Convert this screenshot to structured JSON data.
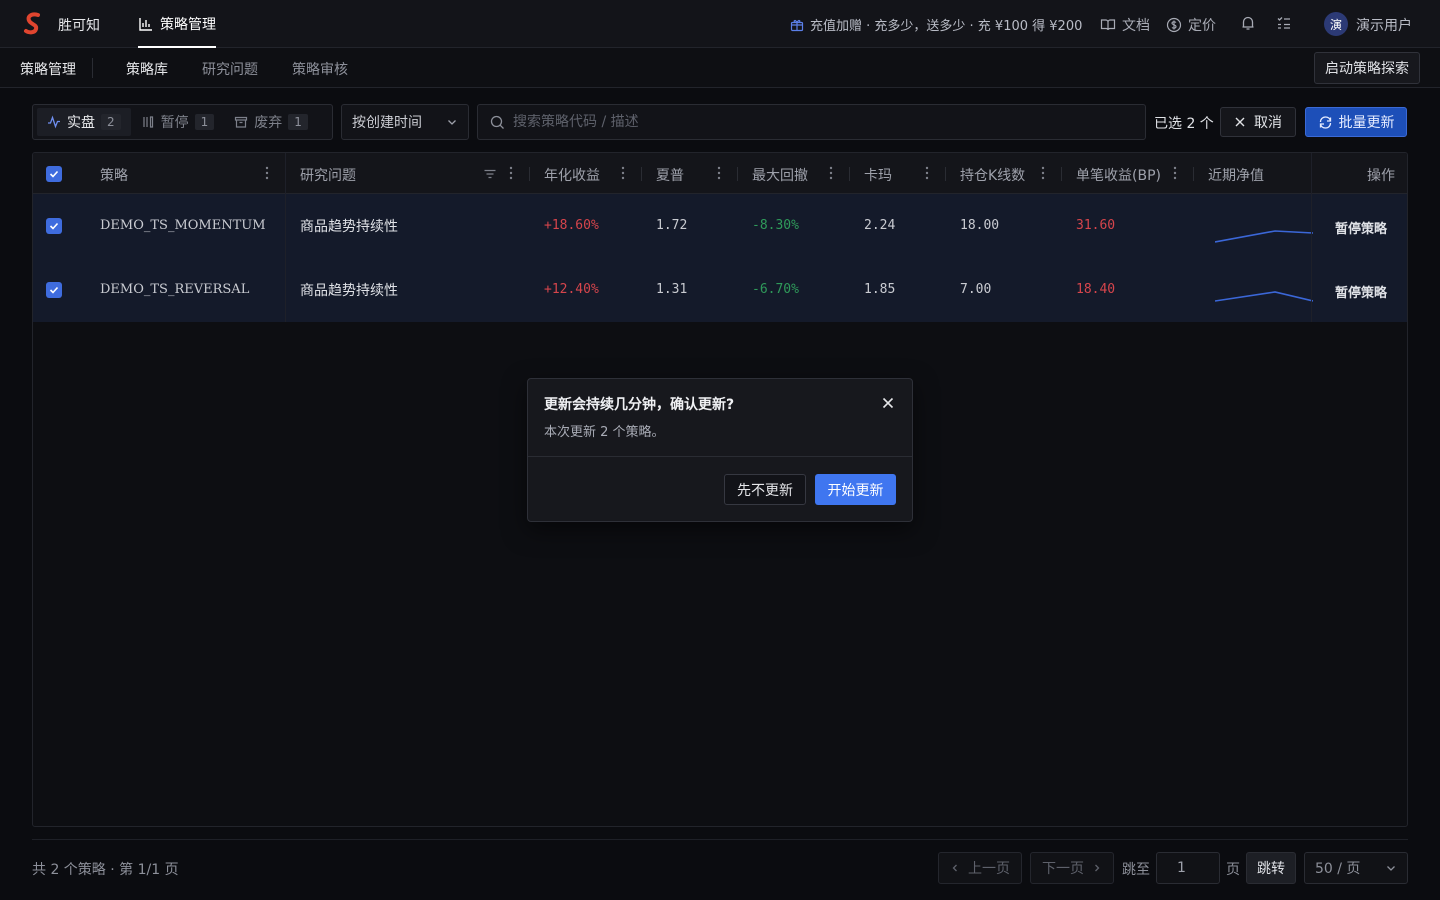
{
  "app": {
    "brand": "胜可知",
    "nav_active": "策略管理",
    "promo": "充值加赠 · 充多少，送多少 · 充 ¥100 得 ¥200",
    "docs": "文档",
    "pricing": "定价",
    "avatar_char": "演",
    "username": "演示用户"
  },
  "subnav": {
    "title": "策略管理",
    "tabs": [
      {
        "label": "策略库",
        "active": true
      },
      {
        "label": "研究问题",
        "active": false
      },
      {
        "label": "策略审核",
        "active": false
      }
    ],
    "explore_button": "启动策略探索"
  },
  "toolbar": {
    "status_filters": [
      {
        "label": "实盘",
        "count": "2",
        "icon": "pulse-icon",
        "active": true
      },
      {
        "label": "暂停",
        "count": "1",
        "icon": "pause-columns-icon",
        "active": false
      },
      {
        "label": "废弃",
        "count": "1",
        "icon": "archive-icon",
        "active": false
      }
    ],
    "sort": "按创建时间",
    "search_placeholder": "搜索策略代码 / 描述",
    "selected": "已选 2 个",
    "cancel": "取消",
    "bulk_update": "批量更新"
  },
  "table": {
    "columns": [
      "策略",
      "研究问题",
      "年化收益",
      "夏普",
      "最大回撤",
      "卡玛",
      "持仓K线数",
      "单笔收益(BP)",
      "近期净值",
      "操作"
    ],
    "rows": [
      {
        "strategy": "DEMO_TS_MOMENTUM",
        "problem": "商品趋势持续性",
        "annual_return": "+18.60%",
        "sharpe": "1.72",
        "max_drawdown": "-8.30%",
        "calmar": "2.24",
        "holding_bars": "18.00",
        "per_trade_bp": "31.60",
        "action": "暂停策略",
        "checked": true
      },
      {
        "strategy": "DEMO_TS_REVERSAL",
        "problem": "商品趋势持续性",
        "annual_return": "+12.40%",
        "sharpe": "1.31",
        "max_drawdown": "-6.70%",
        "calmar": "1.85",
        "holding_bars": "7.00",
        "per_trade_bp": "18.40",
        "action": "暂停策略",
        "checked": true
      }
    ]
  },
  "footer": {
    "summary": "共 2 个策略 · 第 1/1 页",
    "prev": "上一页",
    "next": "下一页",
    "jump_to": "跳至",
    "page_value": "1",
    "page_unit": "页",
    "jump": "跳转",
    "per_page": "50 / 页"
  },
  "dialog": {
    "title": "更新会持续几分钟，确认更新?",
    "description": "本次更新 2 个策略。",
    "secondary": "先不更新",
    "primary": "开始更新"
  },
  "colors": {
    "accent": "#3f76f0",
    "positive": "#d6454c",
    "negative": "#2f9a5a"
  }
}
